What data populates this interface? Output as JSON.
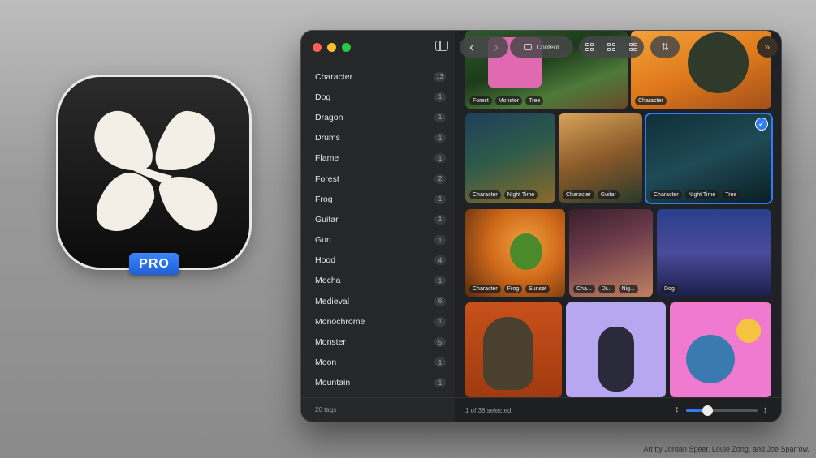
{
  "app_badge": "PRO",
  "window": {
    "sidebar": {
      "tags": [
        {
          "label": "Character",
          "count": "13"
        },
        {
          "label": "Dog",
          "count": "1"
        },
        {
          "label": "Dragon",
          "count": "1"
        },
        {
          "label": "Drums",
          "count": "1"
        },
        {
          "label": "Flame",
          "count": "1"
        },
        {
          "label": "Forest",
          "count": "2"
        },
        {
          "label": "Frog",
          "count": "1"
        },
        {
          "label": "Guitar",
          "count": "1"
        },
        {
          "label": "Gun",
          "count": "1"
        },
        {
          "label": "Hood",
          "count": "4"
        },
        {
          "label": "Mecha",
          "count": "1"
        },
        {
          "label": "Medieval",
          "count": "6"
        },
        {
          "label": "Monochrome",
          "count": "1"
        },
        {
          "label": "Monster",
          "count": "5"
        },
        {
          "label": "Moon",
          "count": "1"
        },
        {
          "label": "Mountain",
          "count": "1"
        }
      ],
      "footer": "20 tags"
    },
    "toolbar": {
      "back": "‹",
      "forward": "›",
      "content_label": "Content",
      "sort_icon": "⇅",
      "expand": "»"
    },
    "grid": {
      "tiles": [
        {
          "tags": [
            "Forest",
            "Monster",
            "Tree"
          ],
          "selected": false
        },
        {
          "tags": [
            "Character"
          ],
          "selected": false
        },
        {
          "tags": [
            "Character",
            "Night Time"
          ],
          "selected": false
        },
        {
          "tags": [
            "Character",
            "Guitar"
          ],
          "selected": false
        },
        {
          "tags": [
            "Character",
            "Night Time",
            "Tree"
          ],
          "selected": true
        },
        {
          "tags": [
            "Character",
            "Frog",
            "Sunset"
          ],
          "selected": false
        },
        {
          "tags": [
            "Cha...",
            "Dr...",
            "Nig..."
          ],
          "selected": false
        },
        {
          "tags": [
            "Dog"
          ],
          "selected": false
        },
        {
          "tags": [],
          "selected": false
        },
        {
          "tags": [],
          "selected": false
        },
        {
          "tags": [],
          "selected": false
        }
      ]
    },
    "status": {
      "selected_text": "1 of 38 selected",
      "zoom_level": 0.3
    }
  },
  "credit": "Art by Jordan Speer, Louie Zong, and Joe Sparrow.",
  "colors": {
    "accent": "#2f7df6",
    "badge": "#2a72e8"
  }
}
